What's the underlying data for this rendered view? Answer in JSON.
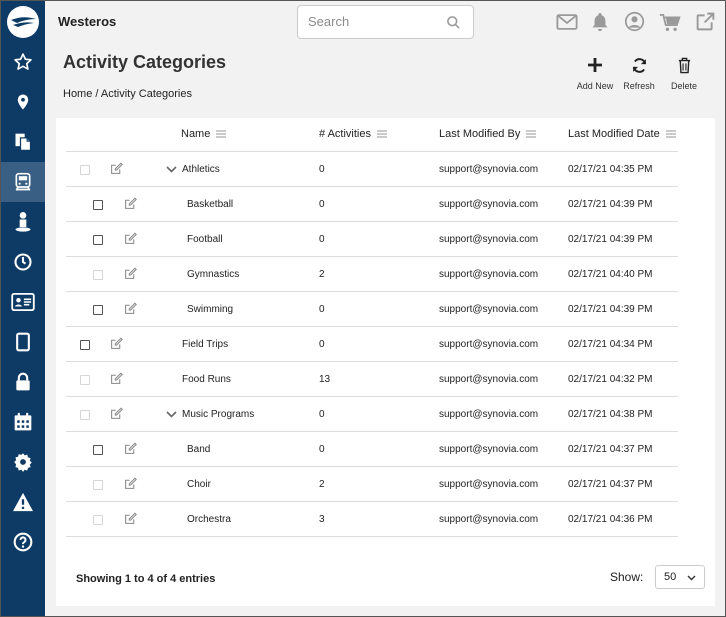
{
  "app": {
    "title": "Westeros"
  },
  "search": {
    "placeholder": "Search"
  },
  "page": {
    "title": "Activity Categories",
    "breadcrumb": "Home / Activity Categories"
  },
  "toolbar": {
    "add_label": "Add New",
    "refresh_label": "Refresh",
    "delete_label": "Delete"
  },
  "sidebar_icons": [
    "star-icon",
    "map-marker-icon",
    "copy-icon",
    "bus-icon",
    "person-icon",
    "clock-icon",
    "id-card-icon",
    "tablet-icon",
    "lock-icon",
    "calendar-icon",
    "gear-icon",
    "warning-icon",
    "help-icon"
  ],
  "table": {
    "headers": {
      "name": "Name",
      "activities": "# Activities",
      "modified_by": "Last Modified By",
      "modified_date": "Last Modified Date"
    },
    "rows": [
      {
        "name": "Athletics",
        "activities": "0",
        "modified_by": "support@synovia.com",
        "modified_date": "02/17/21 04:35 PM"
      },
      {
        "name": "Basketball",
        "activities": "0",
        "modified_by": "support@synovia.com",
        "modified_date": "02/17/21 04:39 PM"
      },
      {
        "name": "Football",
        "activities": "0",
        "modified_by": "support@synovia.com",
        "modified_date": "02/17/21 04:39 PM"
      },
      {
        "name": "Gymnastics",
        "activities": "2",
        "modified_by": "support@synovia.com",
        "modified_date": "02/17/21 04:40 PM"
      },
      {
        "name": "Swimming",
        "activities": "0",
        "modified_by": "support@synovia.com",
        "modified_date": "02/17/21 04:39 PM"
      },
      {
        "name": "Field Trips",
        "activities": "0",
        "modified_by": "support@synovia.com",
        "modified_date": "02/17/21 04:34 PM"
      },
      {
        "name": "Food Runs",
        "activities": "13",
        "modified_by": "support@synovia.com",
        "modified_date": "02/17/21 04:32 PM"
      },
      {
        "name": "Music Programs",
        "activities": "0",
        "modified_by": "support@synovia.com",
        "modified_date": "02/17/21 04:38 PM"
      },
      {
        "name": "Band",
        "activities": "0",
        "modified_by": "support@synovia.com",
        "modified_date": "02/17/21 04:37 PM"
      },
      {
        "name": "Choir",
        "activities": "2",
        "modified_by": "support@synovia.com",
        "modified_date": "02/17/21 04:37 PM"
      },
      {
        "name": "Orchestra",
        "activities": "3",
        "modified_by": "support@synovia.com",
        "modified_date": "02/17/21 04:36 PM"
      }
    ]
  },
  "footer": {
    "info": "Showing 1 to 4 of 4 entries",
    "show_label": "Show:",
    "page_size": "50"
  },
  "colors": {
    "sidebar": "#0d3b66",
    "sidebar_active": "#3a5f84",
    "page_bg": "#f2f2f2",
    "icon_gray": "#9a9a9a"
  }
}
